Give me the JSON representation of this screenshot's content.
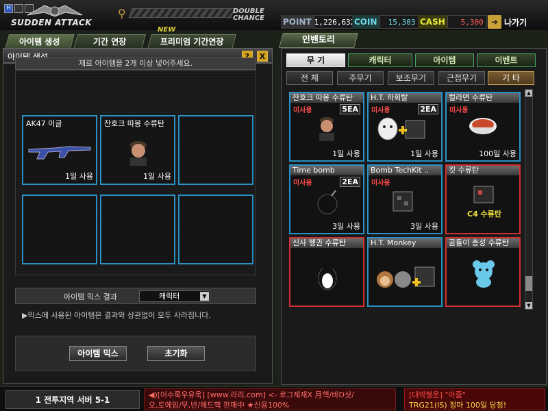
{
  "header": {
    "sys_h": "H",
    "logo_text": "SUDDEN ATTACK",
    "double_chance": [
      "DOUBLE",
      "CHANCE"
    ]
  },
  "currency": {
    "point_label": "POINT",
    "point_value": "1,226,632",
    "coin_label": "COIN",
    "coin_value": "15,303",
    "cash_label": "CASH",
    "cash_value": "5,300",
    "exit_label": "나가기"
  },
  "left": {
    "tabs": [
      "아이템 생성",
      "기간 연장",
      "프리미엄 기간연장"
    ],
    "new_badge": "NEW",
    "panel_title": "아이템 생성",
    "help": "?",
    "close": "X",
    "notice": "재료 아이템을 2개 이상 넣어주세요.",
    "slots": [
      {
        "name": "AK47 이글",
        "use": "1일 사용"
      },
      {
        "name": "잔호크 따봉 수류탄",
        "use": "1일 사용"
      }
    ],
    "mix_label": "아이템 믹스 결과",
    "mix_value": "캐릭터",
    "mix_note": "▶믹스에 사용된 아이템은 결과와 상관없이 모두 사라집니다.",
    "mix_button": "아이템 믹스",
    "reset_button": "초기화"
  },
  "right": {
    "inventory_tab": "인벤토리",
    "categories": [
      "무 기",
      "캐릭터",
      "아이템",
      "이벤트"
    ],
    "subcats": [
      "전 체",
      "주무기",
      "보조무기",
      "근접무기",
      "기 타"
    ],
    "items": [
      {
        "name": "잔호크 따봉 수류탄",
        "tag": "미사용",
        "ea": "5EA",
        "use": "1일 사용",
        "color": "blue"
      },
      {
        "name": "H.T. 하회탈",
        "tag": "미사용",
        "ea": "2EA",
        "use": "1일 사용",
        "color": "blue"
      },
      {
        "name": "컬라면 수류탄",
        "tag": "미사용",
        "ea": "",
        "use": "100일 사용",
        "color": "blue"
      },
      {
        "name": "Time bomb",
        "tag": "미사용",
        "ea": "2EA",
        "use": "3일 사용",
        "color": "blue"
      },
      {
        "name": "Bomb TechKit ..",
        "tag": "미사용",
        "ea": "",
        "use": "3일 사용",
        "color": "blue"
      },
      {
        "name": "킷 수류탄",
        "tag": "",
        "ea": "",
        "use": "",
        "color": "red",
        "overlay": "C4 수류탄"
      },
      {
        "name": "신사 펭귄 수류탄",
        "tag": "",
        "ea": "",
        "use": "",
        "color": "red"
      },
      {
        "name": "H.T. Monkey",
        "tag": "",
        "ea": "",
        "use": "",
        "color": "blue"
      },
      {
        "name": "곰돌이 총성 수류탄",
        "tag": "",
        "ea": "",
        "use": "",
        "color": "red"
      }
    ]
  },
  "bottom": {
    "server": "1 전투지역 서버 5-1",
    "chat_line1": "◀)[어수룩우유욱] [www.라리.com] <- 로그제재X 月핵/바D샷/",
    "chat_line2": "오,토에임/무,반/헤드핵 판매中 ★신용100%",
    "ann_line1": "[대박행운] \"아줌\"",
    "ann_line2": "TRG21(IS) 정마 100일 당첨!"
  }
}
